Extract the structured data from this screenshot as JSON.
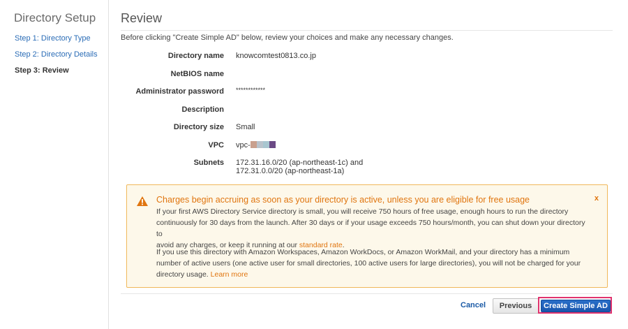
{
  "sidebar": {
    "title": "Directory Setup",
    "steps": [
      {
        "label": "Step 1: Directory Type"
      },
      {
        "label": "Step 2: Directory Details"
      },
      {
        "label": "Step 3: Review"
      }
    ]
  },
  "main": {
    "title": "Review",
    "intro": "Before clicking \"Create Simple AD\" below, review your choices and make any necessary changes.",
    "fields": {
      "directory_name": {
        "label": "Directory name",
        "value": "knowcomtest0813.co.jp"
      },
      "netbios_name": {
        "label": "NetBIOS name",
        "value": ""
      },
      "admin_password": {
        "label": "Administrator password",
        "value": "************"
      },
      "description": {
        "label": "Description",
        "value": ""
      },
      "directory_size": {
        "label": "Directory size",
        "value": "Small"
      },
      "vpc": {
        "label": "VPC",
        "value": "vpc-",
        "redaction_colors": [
          "#c9a08e",
          "#b9c3cc",
          "#a8c6d0",
          "#6b4a86"
        ]
      },
      "subnets": {
        "label": "Subnets",
        "line1": "172.31.16.0/20 (ap-northeast-1c) and",
        "line2": "172.31.0.0/20 (ap-northeast-1a)"
      }
    }
  },
  "warning": {
    "icon": "warning-triangle-icon",
    "title": "Charges begin accruing as soon as your directory is active, unless you are eligible for free usage",
    "close": "x",
    "para1_line1": "If your first AWS Directory Service directory is small, you will receive 750 hours of free usage, enough hours to run the directory",
    "para1_line2": "continuously for 30 days from the launch. After 30 days or if your usage exceeds 750 hours/month, you can shut down your directory to",
    "para1_line3": "avoid any charges, or keep it running at our",
    "para1_link": "standard rate",
    "para1_end": ".",
    "para2_line1": "If you use this directory with Amazon Workspaces, Amazon WorkDocs, or Amazon WorkMail, and your directory has a minimum",
    "para2_line2": "number of active users (one active user for small directories, 100 active users for large directories), you will not be charged for your",
    "para2_line3": "directory usage.",
    "para2_link": "Learn more"
  },
  "actions": {
    "cancel": "Cancel",
    "previous": "Previous",
    "create": "Create Simple AD"
  },
  "colors": {
    "link": "#2a6cb6",
    "warning_accent": "#e0750f",
    "primary_button": "#1a56ad",
    "highlight_border": "#e0336e"
  }
}
